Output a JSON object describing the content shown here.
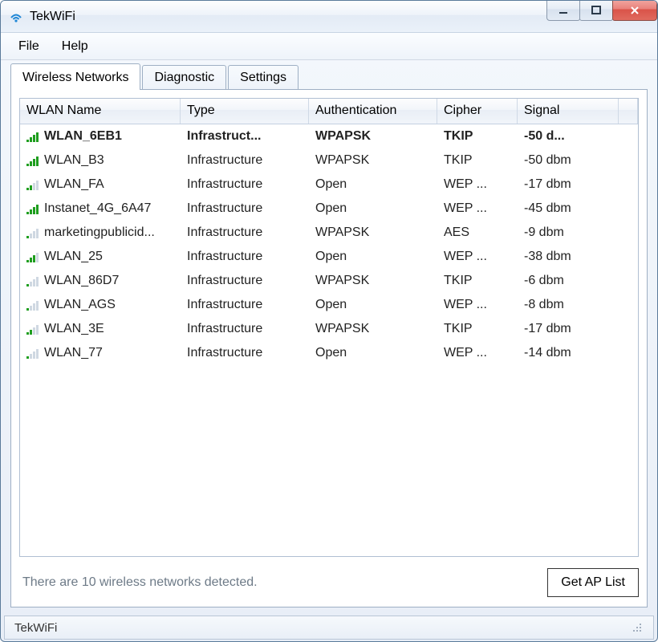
{
  "window": {
    "title": "TekWiFi"
  },
  "menu": {
    "items": [
      "File",
      "Help"
    ]
  },
  "tabs": {
    "items": [
      "Wireless Networks",
      "Diagnostic",
      "Settings"
    ],
    "active_index": 0
  },
  "list": {
    "columns": [
      "WLAN Name",
      "Type",
      "Authentication",
      "Cipher",
      "Signal"
    ],
    "rows": [
      {
        "name": "WLAN_6EB1",
        "type": "Infrastruct...",
        "auth": "WPAPSK",
        "cipher": "TKIP",
        "signal": "-50 d...",
        "bars": 4,
        "bold": true
      },
      {
        "name": "WLAN_B3",
        "type": "Infrastructure",
        "auth": "WPAPSK",
        "cipher": "TKIP",
        "signal": "-50 dbm",
        "bars": 4,
        "bold": false
      },
      {
        "name": "WLAN_FA",
        "type": "Infrastructure",
        "auth": "Open",
        "cipher": "WEP ...",
        "signal": "-17 dbm",
        "bars": 2,
        "bold": false
      },
      {
        "name": "Instanet_4G_6A47",
        "type": "Infrastructure",
        "auth": "Open",
        "cipher": "WEP ...",
        "signal": "-45 dbm",
        "bars": 4,
        "bold": false
      },
      {
        "name": "marketingpublicid...",
        "type": "Infrastructure",
        "auth": "WPAPSK",
        "cipher": "AES",
        "signal": "-9 dbm",
        "bars": 1,
        "bold": false
      },
      {
        "name": "WLAN_25",
        "type": "Infrastructure",
        "auth": "Open",
        "cipher": "WEP ...",
        "signal": "-38 dbm",
        "bars": 3,
        "bold": false
      },
      {
        "name": "WLAN_86D7",
        "type": "Infrastructure",
        "auth": "WPAPSK",
        "cipher": "TKIP",
        "signal": "-6 dbm",
        "bars": 1,
        "bold": false
      },
      {
        "name": "WLAN_AGS",
        "type": "Infrastructure",
        "auth": "Open",
        "cipher": "WEP ...",
        "signal": "-8 dbm",
        "bars": 1,
        "bold": false
      },
      {
        "name": "WLAN_3E",
        "type": "Infrastructure",
        "auth": "WPAPSK",
        "cipher": "TKIP",
        "signal": "-17 dbm",
        "bars": 2,
        "bold": false
      },
      {
        "name": "WLAN_77",
        "type": "Infrastructure",
        "auth": "Open",
        "cipher": "WEP ...",
        "signal": "-14 dbm",
        "bars": 1,
        "bold": false
      }
    ]
  },
  "footer": {
    "status": "There are 10 wireless networks detected.",
    "button": "Get AP List"
  },
  "statusbar": {
    "text": "TekWiFi"
  }
}
